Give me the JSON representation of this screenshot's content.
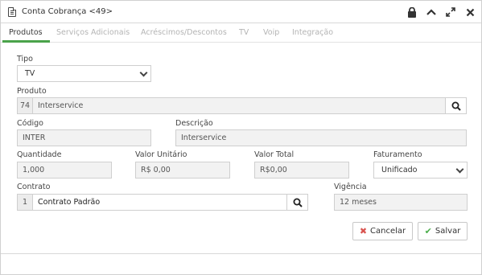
{
  "window": {
    "title": "Conta Cobrança <49>",
    "icons": {
      "app": "document-icon",
      "lock": "lock-icon",
      "collapse": "chevron-up-icon",
      "maximize": "expand-icon",
      "close": "close-icon"
    }
  },
  "tabs": [
    {
      "label": "Produtos",
      "active": true
    },
    {
      "label": "Serviços Adicionais",
      "active": false
    },
    {
      "label": "Acréscimos/Descontos",
      "active": false
    },
    {
      "label": "TV",
      "active": false
    },
    {
      "label": "Voip",
      "active": false
    },
    {
      "label": "Integração",
      "active": false
    }
  ],
  "form": {
    "tipo": {
      "label": "Tipo",
      "value": "TV"
    },
    "produto": {
      "label": "Produto",
      "code": "74",
      "value": "Interservice"
    },
    "codigo": {
      "label": "Código",
      "value": "INTER"
    },
    "descricao": {
      "label": "Descrição",
      "value": "Interservice"
    },
    "quantidade": {
      "label": "Quantidade",
      "value": "1,000"
    },
    "valor_unitario": {
      "label": "Valor Unitário",
      "value": "R$ 0,00"
    },
    "valor_total": {
      "label": "Valor Total",
      "value": "R$0,00"
    },
    "faturamento": {
      "label": "Faturamento",
      "value": "Unificado"
    },
    "contrato": {
      "label": "Contrato",
      "code": "1",
      "value": "Contrato Padrão"
    },
    "vigencia": {
      "label": "Vigência",
      "value": "12 meses"
    }
  },
  "buttons": {
    "cancel": "Cancelar",
    "save": "Salvar"
  },
  "colors": {
    "accent_green": "#4aa34a",
    "cancel_red": "#d9534f",
    "save_green": "#4cae4c"
  }
}
